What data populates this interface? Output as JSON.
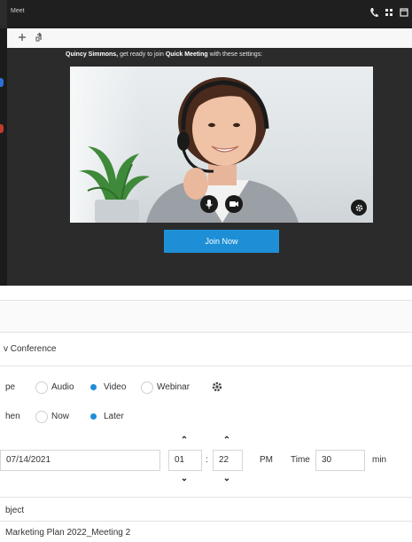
{
  "window": {
    "app_title": "Meet",
    "title_icons": [
      "phone-icon",
      "grid-icon",
      "window-icon"
    ],
    "toolbar_icons": [
      "plus-icon",
      "share-icon"
    ]
  },
  "preview": {
    "prompt_name": "Quincy Simmons,",
    "prompt_mid": " get ready to join ",
    "prompt_meeting": "Quick Meeting",
    "prompt_end": " with these settings:",
    "join_label": "Join Now",
    "media_buttons": [
      "microphone-icon",
      "camera-icon"
    ],
    "settings_icon": "gear-icon"
  },
  "form": {
    "section_title": "v Conference",
    "type_label": "pe",
    "type_options": [
      {
        "label": "Audio",
        "selected": false
      },
      {
        "label": "Video",
        "selected": true
      },
      {
        "label": "Webinar",
        "selected": false
      }
    ],
    "when_label": "hen",
    "when_options": [
      {
        "label": "Now",
        "selected": false
      },
      {
        "label": "Later",
        "selected": true
      }
    ],
    "date_value": "07/14/2021",
    "hour_value": "01",
    "time_separator": ":",
    "minute_value": "22",
    "ampm": "PM",
    "duration_label": "Time",
    "duration_value": "30",
    "duration_unit": "min",
    "subject_label": "bject",
    "subject_value": "Marketing Plan 2022_Meeting 2"
  },
  "colors": {
    "accent": "#1e8fd6",
    "dark_bg": "#2b2b2b",
    "titlebar": "#1f1f1f"
  }
}
